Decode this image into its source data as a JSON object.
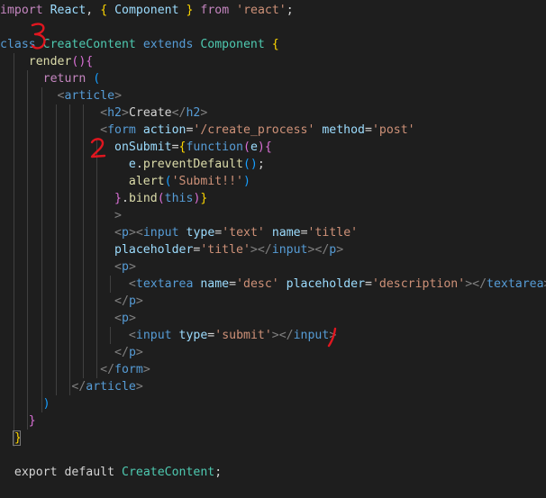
{
  "editor": {
    "lines": [
      [
        {
          "c": "k-import",
          "t": "import"
        },
        {
          "c": "k-plain",
          "t": " "
        },
        {
          "c": "k-id",
          "t": "React"
        },
        {
          "c": "k-plain",
          "t": ", "
        },
        {
          "c": "k-brace",
          "t": "{"
        },
        {
          "c": "k-plain",
          "t": " "
        },
        {
          "c": "k-id",
          "t": "Component"
        },
        {
          "c": "k-plain",
          "t": " "
        },
        {
          "c": "k-brace",
          "t": "}"
        },
        {
          "c": "k-plain",
          "t": " "
        },
        {
          "c": "k-from",
          "t": "from"
        },
        {
          "c": "k-plain",
          "t": " "
        },
        {
          "c": "k-str",
          "t": "'react'"
        },
        {
          "c": "k-plain",
          "t": ";"
        }
      ],
      [],
      [
        {
          "c": "k-blue",
          "t": "class"
        },
        {
          "c": "k-plain",
          "t": " "
        },
        {
          "c": "k-class",
          "t": "CreateContent"
        },
        {
          "c": "k-plain",
          "t": " "
        },
        {
          "c": "k-blue",
          "t": "extends"
        },
        {
          "c": "k-plain",
          "t": " "
        },
        {
          "c": "k-class",
          "t": "Component"
        },
        {
          "c": "k-plain",
          "t": " "
        },
        {
          "c": "k-brace",
          "t": "{"
        }
      ],
      [
        {
          "c": "k-plain",
          "t": "    "
        },
        {
          "c": "k-func",
          "t": "render"
        },
        {
          "c": "k-brace2",
          "t": "()"
        },
        {
          "c": "k-brace2",
          "t": "{"
        }
      ],
      [
        {
          "c": "k-plain",
          "t": "      "
        },
        {
          "c": "k-return",
          "t": "return"
        },
        {
          "c": "k-plain",
          "t": " "
        },
        {
          "c": "k-brace3",
          "t": "("
        }
      ],
      [
        {
          "c": "k-plain",
          "t": "        "
        },
        {
          "c": "k-angle",
          "t": "<"
        },
        {
          "c": "k-tag",
          "t": "article"
        },
        {
          "c": "k-angle",
          "t": ">"
        }
      ],
      [
        {
          "c": "k-plain",
          "t": "              "
        },
        {
          "c": "k-angle",
          "t": "<"
        },
        {
          "c": "k-tag",
          "t": "h2"
        },
        {
          "c": "k-angle",
          "t": ">"
        },
        {
          "c": "k-plain",
          "t": "Create"
        },
        {
          "c": "k-angle",
          "t": "</"
        },
        {
          "c": "k-tag",
          "t": "h2"
        },
        {
          "c": "k-angle",
          "t": ">"
        }
      ],
      [
        {
          "c": "k-plain",
          "t": "              "
        },
        {
          "c": "k-angle",
          "t": "<"
        },
        {
          "c": "k-tag",
          "t": "form"
        },
        {
          "c": "k-plain",
          "t": " "
        },
        {
          "c": "k-attr",
          "t": "action"
        },
        {
          "c": "k-plain",
          "t": "="
        },
        {
          "c": "k-str",
          "t": "'/create_process'"
        },
        {
          "c": "k-plain",
          "t": " "
        },
        {
          "c": "k-attr",
          "t": "method"
        },
        {
          "c": "k-plain",
          "t": "="
        },
        {
          "c": "k-str",
          "t": "'post'"
        }
      ],
      [
        {
          "c": "k-plain",
          "t": "                "
        },
        {
          "c": "k-attr",
          "t": "onSubmit"
        },
        {
          "c": "k-plain",
          "t": "="
        },
        {
          "c": "k-brace",
          "t": "{"
        },
        {
          "c": "k-blue",
          "t": "function"
        },
        {
          "c": "k-brace2",
          "t": "("
        },
        {
          "c": "k-id",
          "t": "e"
        },
        {
          "c": "k-brace2",
          "t": ")"
        },
        {
          "c": "k-brace2",
          "t": "{"
        }
      ],
      [
        {
          "c": "k-plain",
          "t": "                  "
        },
        {
          "c": "k-id",
          "t": "e"
        },
        {
          "c": "k-plain",
          "t": "."
        },
        {
          "c": "k-func",
          "t": "preventDefault"
        },
        {
          "c": "k-brace3",
          "t": "()"
        },
        {
          "c": "k-plain",
          "t": ";"
        }
      ],
      [
        {
          "c": "k-plain",
          "t": "                  "
        },
        {
          "c": "k-func",
          "t": "alert"
        },
        {
          "c": "k-brace3",
          "t": "("
        },
        {
          "c": "k-str",
          "t": "'Submit!!'"
        },
        {
          "c": "k-brace3",
          "t": ")"
        }
      ],
      [
        {
          "c": "k-plain",
          "t": "                "
        },
        {
          "c": "k-brace2",
          "t": "}"
        },
        {
          "c": "k-plain",
          "t": "."
        },
        {
          "c": "k-func",
          "t": "bind"
        },
        {
          "c": "k-brace2",
          "t": "("
        },
        {
          "c": "k-blue",
          "t": "this"
        },
        {
          "c": "k-brace2",
          "t": ")"
        },
        {
          "c": "k-brace",
          "t": "}"
        }
      ],
      [
        {
          "c": "k-plain",
          "t": "                "
        },
        {
          "c": "k-angle",
          "t": ">"
        }
      ],
      [
        {
          "c": "k-plain",
          "t": "                "
        },
        {
          "c": "k-angle",
          "t": "<"
        },
        {
          "c": "k-tag",
          "t": "p"
        },
        {
          "c": "k-angle",
          "t": "><"
        },
        {
          "c": "k-tag",
          "t": "input"
        },
        {
          "c": "k-plain",
          "t": " "
        },
        {
          "c": "k-attr",
          "t": "type"
        },
        {
          "c": "k-plain",
          "t": "="
        },
        {
          "c": "k-str",
          "t": "'text'"
        },
        {
          "c": "k-plain",
          "t": " "
        },
        {
          "c": "k-attr",
          "t": "name"
        },
        {
          "c": "k-plain",
          "t": "="
        },
        {
          "c": "k-str",
          "t": "'title'"
        }
      ],
      [
        {
          "c": "k-plain",
          "t": "                "
        },
        {
          "c": "k-attr",
          "t": "placeholder"
        },
        {
          "c": "k-plain",
          "t": "="
        },
        {
          "c": "k-str",
          "t": "'title'"
        },
        {
          "c": "k-angle",
          "t": "></"
        },
        {
          "c": "k-tag",
          "t": "input"
        },
        {
          "c": "k-angle",
          "t": "></"
        },
        {
          "c": "k-tag",
          "t": "p"
        },
        {
          "c": "k-angle",
          "t": ">"
        }
      ],
      [
        {
          "c": "k-plain",
          "t": "                "
        },
        {
          "c": "k-angle",
          "t": "<"
        },
        {
          "c": "k-tag",
          "t": "p"
        },
        {
          "c": "k-angle",
          "t": ">"
        }
      ],
      [
        {
          "c": "k-plain",
          "t": "                  "
        },
        {
          "c": "k-angle",
          "t": "<"
        },
        {
          "c": "k-tag",
          "t": "textarea"
        },
        {
          "c": "k-plain",
          "t": " "
        },
        {
          "c": "k-attr",
          "t": "name"
        },
        {
          "c": "k-plain",
          "t": "="
        },
        {
          "c": "k-str",
          "t": "'desc'"
        },
        {
          "c": "k-plain",
          "t": " "
        },
        {
          "c": "k-attr",
          "t": "placeholder"
        },
        {
          "c": "k-plain",
          "t": "="
        },
        {
          "c": "k-str",
          "t": "'description'"
        },
        {
          "c": "k-angle",
          "t": "></"
        },
        {
          "c": "k-tag",
          "t": "textarea"
        },
        {
          "c": "k-angle",
          "t": ">"
        }
      ],
      [
        {
          "c": "k-plain",
          "t": "                "
        },
        {
          "c": "k-angle",
          "t": "</"
        },
        {
          "c": "k-tag",
          "t": "p"
        },
        {
          "c": "k-angle",
          "t": ">"
        }
      ],
      [
        {
          "c": "k-plain",
          "t": "                "
        },
        {
          "c": "k-angle",
          "t": "<"
        },
        {
          "c": "k-tag",
          "t": "p"
        },
        {
          "c": "k-angle",
          "t": ">"
        }
      ],
      [
        {
          "c": "k-plain",
          "t": "                  "
        },
        {
          "c": "k-angle",
          "t": "<"
        },
        {
          "c": "k-tag",
          "t": "input"
        },
        {
          "c": "k-plain",
          "t": " "
        },
        {
          "c": "k-attr",
          "t": "type"
        },
        {
          "c": "k-plain",
          "t": "="
        },
        {
          "c": "k-str",
          "t": "'submit'"
        },
        {
          "c": "k-angle",
          "t": "></"
        },
        {
          "c": "k-tag",
          "t": "input"
        },
        {
          "c": "k-angle",
          "t": ">"
        }
      ],
      [
        {
          "c": "k-plain",
          "t": "                "
        },
        {
          "c": "k-angle",
          "t": "</"
        },
        {
          "c": "k-tag",
          "t": "p"
        },
        {
          "c": "k-angle",
          "t": ">"
        }
      ],
      [
        {
          "c": "k-plain",
          "t": "              "
        },
        {
          "c": "k-angle",
          "t": "</"
        },
        {
          "c": "k-tag",
          "t": "form"
        },
        {
          "c": "k-angle",
          "t": ">"
        }
      ],
      [
        {
          "c": "k-plain",
          "t": "          "
        },
        {
          "c": "k-angle",
          "t": "</"
        },
        {
          "c": "k-tag",
          "t": "article"
        },
        {
          "c": "k-angle",
          "t": ">"
        }
      ],
      [
        {
          "c": "k-plain",
          "t": "      "
        },
        {
          "c": "k-brace3",
          "t": ")"
        }
      ],
      [
        {
          "c": "k-plain",
          "t": "    "
        },
        {
          "c": "k-brace2",
          "t": "}"
        }
      ],
      [
        {
          "c": "k-plain",
          "t": "  "
        },
        {
          "c": "k-brace",
          "t": "}"
        }
      ],
      [],
      [
        {
          "c": "k-plain",
          "t": "  "
        },
        {
          "c": "k-plain",
          "t": "export"
        },
        {
          "c": "k-plain",
          "t": " "
        },
        {
          "c": "k-plain",
          "t": "default"
        },
        {
          "c": "k-plain",
          "t": " "
        },
        {
          "c": "k-class",
          "t": "CreateContent"
        },
        {
          "c": "k-plain",
          "t": ";"
        }
      ]
    ]
  },
  "annotations": {
    "color": "#e0161f",
    "marks": [
      "1",
      "2",
      "3"
    ]
  }
}
